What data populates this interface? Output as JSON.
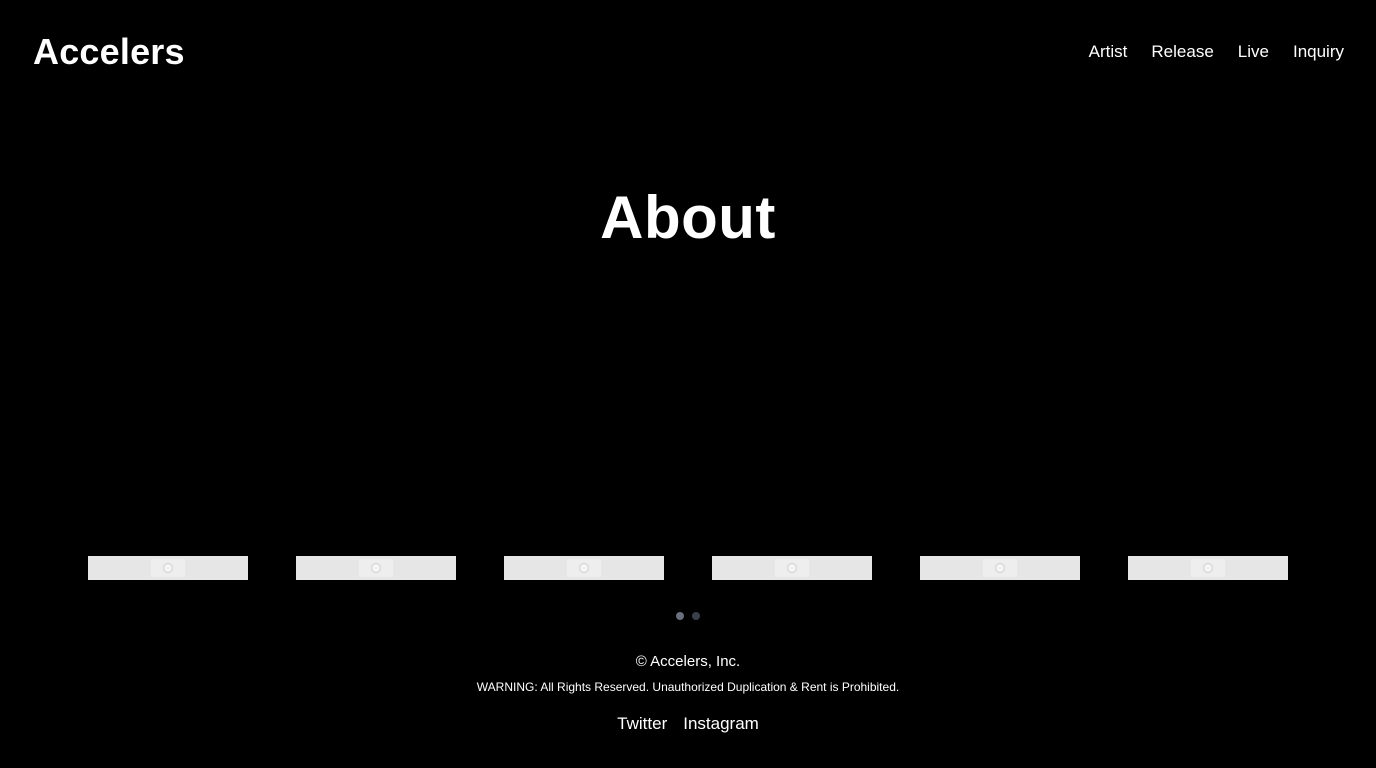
{
  "header": {
    "logo": "Accelers",
    "nav": [
      "Artist",
      "Release",
      "Live",
      "Inquiry"
    ]
  },
  "hero": {
    "title": "About"
  },
  "carousel": {
    "slide_count": 6,
    "placeholder_icon": "image-placeholder-icon",
    "page_count": 2,
    "active_page": 1
  },
  "footer": {
    "copyright": "© Accelers, Inc.",
    "warning": "WARNING: All Rights Reserved. Unauthorized Duplication & Rent is Prohibited.",
    "links": [
      "Twitter",
      "Instagram"
    ]
  },
  "colors": {
    "background": "#000000",
    "text": "#ffffff",
    "slide_placeholder": "#e6e6e6",
    "pager_active": "#6b7080",
    "pager_inactive": "#3b3f4a"
  }
}
